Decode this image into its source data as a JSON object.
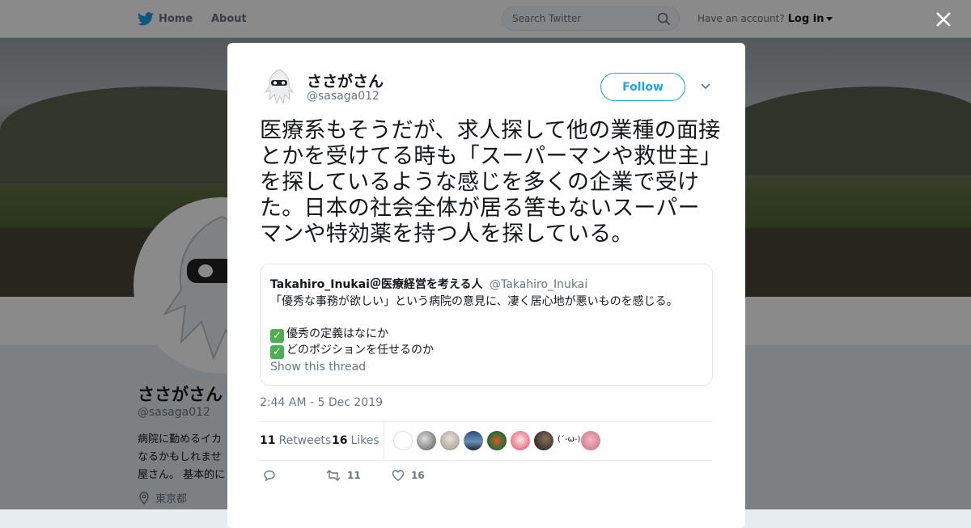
{
  "topbar": {
    "home_label": "Home",
    "about_label": "About",
    "search_placeholder": "Search Twitter",
    "account_prompt": "Have an account?",
    "login_label": "Log in"
  },
  "profile": {
    "name": "ささがさん",
    "handle": "@sasaga012",
    "bio": "病院に勤めるイカ\nなるかもしれませ\n屋さん。 基本的に",
    "location": "東京都"
  },
  "tweet": {
    "author_name": "ささがさん",
    "author_handle": "@sasaga012",
    "follow_label": "Follow",
    "text": "医療系もそうだが、求人探して他の業種の面接とかを受けてる時も「スーパーマンや救世主」を探しているような感じを多くの企業で受けた。日本の社会全体が居る筈もないスーパーマンや特効薬を持つ人を探している。",
    "quoted": {
      "author_name": "Takahiro_Inukai＠医療経営を考える人",
      "author_handle": "@Takahiro_Inukai",
      "line1": "「優秀な事務が欲しい」という病院の意見に、凄く居心地が悪いものを感じる。",
      "line2": "優秀の定義はなにか",
      "line3": "どのポジションを任せるのか",
      "show_thread": "Show this thread"
    },
    "timestamp": "2:44 AM - 5 Dec 2019",
    "retweets_count": "11",
    "retweets_label": "Retweets",
    "likes_count": "16",
    "likes_label": "Likes",
    "liker_text_avatar": "(´-ω-)",
    "actions": {
      "retweet_count": "11",
      "like_count": "16"
    }
  },
  "colors": {
    "brand": "#1da1f2",
    "check": "#4caf50"
  }
}
